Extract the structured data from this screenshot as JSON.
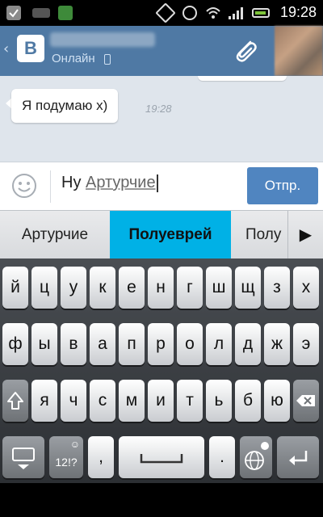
{
  "status_bar": {
    "time": "19:28",
    "icons": [
      "checkbox-notification-icon",
      "keyboard-notification-icon",
      "app-notification-icon",
      "rotate-lock-icon",
      "alarm-icon",
      "wifi-icon",
      "signal-icon",
      "battery-icon"
    ]
  },
  "header": {
    "logo_text": "В",
    "status": "Онлайн",
    "icons": [
      "back-chevron-icon",
      "phone-icon",
      "paperclip-icon"
    ]
  },
  "chat": {
    "messages": [
      {
        "text": "Я подумаю х)",
        "time": "19:28"
      }
    ]
  },
  "composer": {
    "typed_word": "Ну",
    "suggested_word": "Артурчие",
    "send_label": "Отпр."
  },
  "suggestions": {
    "items": [
      "Артурчие",
      "Полуеврей",
      "Полу"
    ],
    "selected": "Полуеврей",
    "more_symbol": "▶"
  },
  "keyboard": {
    "row1": [
      "й",
      "ц",
      "у",
      "к",
      "е",
      "н",
      "г",
      "ш",
      "щ",
      "з",
      "х"
    ],
    "row2": [
      "ф",
      "ы",
      "в",
      "а",
      "п",
      "р",
      "о",
      "л",
      "д",
      "ж",
      "э"
    ],
    "row3": [
      "я",
      "ч",
      "с",
      "м",
      "и",
      "т",
      "ь",
      "б",
      "ю"
    ],
    "symbols_label": "12!?",
    "comma": ",",
    "period": ".",
    "icons": [
      "shift-icon",
      "backspace-icon",
      "hide-keyboard-icon",
      "emoji-key-icon",
      "space-icon",
      "language-globe-icon",
      "enter-icon"
    ]
  },
  "colors": {
    "header": "#4f79a4",
    "chat_bg": "#dfe5ec",
    "send_button": "#5085c0",
    "suggestion_highlight": "#00b1e6"
  }
}
